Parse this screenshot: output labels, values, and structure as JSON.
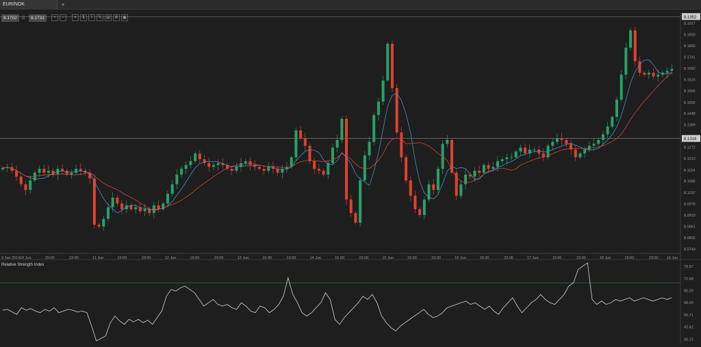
{
  "tab": {
    "title": "EUR/NOK",
    "add": "+"
  },
  "quotes": {
    "bid": "8.1702",
    "sep": "|||",
    "ask": "8.1731"
  },
  "toolbar": {
    "tools": [
      {
        "name": "zoom-in-icon",
        "glyph": "+"
      },
      {
        "name": "zoom-out-icon",
        "glyph": "−"
      },
      {
        "name": "crosshair-icon",
        "glyph": "⌖"
      },
      {
        "name": "candles-icon",
        "glyph": "⫼"
      },
      {
        "name": "indicators-icon",
        "glyph": "⌇"
      },
      {
        "name": "draw-icon",
        "glyph": "✎"
      },
      {
        "name": "template-icon",
        "glyph": "▤"
      },
      {
        "name": "settings-icon",
        "glyph": "⚙"
      },
      {
        "name": "screenshot-icon",
        "glyph": "▣"
      }
    ]
  },
  "rsi": {
    "title": "Relative Strength Index"
  },
  "price_marks": {
    "top": "8.1952",
    "current": "8.1318"
  },
  "colors": {
    "up": "#26a269",
    "down": "#e04030",
    "ma_fast": "#4a90c8",
    "ma_slow": "#d04a3a",
    "rsi_line": "#d8d8d8",
    "rsi_band": "#2e6b3e"
  },
  "chart_data": {
    "type": "candlestick",
    "instrument": "EUR/NOK",
    "price_ticks": [
      "8.1917",
      "8.1859",
      "8.1800",
      "8.1741",
      "8.1682",
      "8.1624",
      "8.1565",
      "8.1506",
      "8.1448",
      "8.1389",
      "8.1272",
      "8.1213",
      "8.1154",
      "8.1096",
      "8.1037",
      "8.0978",
      "8.0919",
      "8.0861",
      "8.0802",
      "8.0743"
    ],
    "ylim": [
      8.072,
      8.196
    ],
    "time_ticks": [
      "9 Jun 2014",
      "10 Jun",
      "15:00",
      "23:00",
      "11 Jun",
      "15:00",
      "23:00",
      "12 Jun",
      "15:00",
      "23:00",
      "13 Jun",
      "15:00",
      "23:00",
      "14 Jun",
      "15:00",
      "23:00",
      "15 Jun",
      "15:00",
      "23:00",
      "16 Jun",
      "15:00",
      "23:00",
      "17 Jun",
      "15:00",
      "23:00",
      "18 Jun",
      "15:00",
      "23:00",
      "19 Jun"
    ],
    "rsi_ticks": [
      "79.87",
      "72.58",
      "65.29",
      "58.00",
      "50.71",
      "43.42",
      "36.13"
    ],
    "rsi_ylim": [
      33,
      84
    ],
    "rsi_levels": [
      70,
      30
    ],
    "close": [
      8.1165,
      8.117,
      8.115,
      8.112,
      8.108,
      8.105,
      8.11,
      8.114,
      8.116,
      8.114,
      8.115,
      8.113,
      8.116,
      8.115,
      8.113,
      8.114,
      8.116,
      8.115,
      8.114,
      8.111,
      8.087,
      8.086,
      8.09,
      8.096,
      8.101,
      8.098,
      8.095,
      8.097,
      8.095,
      8.096,
      8.094,
      8.095,
      8.093,
      8.097,
      8.095,
      8.098,
      8.103,
      8.108,
      8.113,
      8.116,
      8.118,
      8.12,
      8.124,
      8.121,
      8.119,
      8.117,
      8.118,
      8.119,
      8.118,
      8.116,
      8.115,
      8.117,
      8.119,
      8.12,
      8.118,
      8.117,
      8.116,
      8.115,
      8.117,
      8.116,
      8.114,
      8.116,
      8.117,
      8.122,
      8.136,
      8.132,
      8.128,
      8.12,
      8.116,
      8.115,
      8.113,
      8.119,
      8.127,
      8.131,
      8.142,
      8.1,
      8.093,
      8.088,
      8.11,
      8.123,
      8.13,
      8.144,
      8.151,
      8.162,
      8.181,
      8.158,
      8.135,
      8.122,
      8.11,
      8.102,
      8.095,
      8.092,
      8.1,
      8.108,
      8.105,
      8.116,
      8.129,
      8.131,
      8.114,
      8.102,
      8.108,
      8.113,
      8.112,
      8.115,
      8.114,
      8.118,
      8.116,
      8.117,
      8.12,
      8.121,
      8.122,
      8.122,
      8.125,
      8.127,
      8.124,
      8.126,
      8.126,
      8.124,
      8.122,
      8.128,
      8.13,
      8.132,
      8.131,
      8.129,
      8.126,
      8.122,
      8.124,
      8.126,
      8.128,
      8.129,
      8.131,
      8.134,
      8.138,
      8.143,
      8.152,
      8.165,
      8.179,
      8.188,
      8.172,
      8.166,
      8.165,
      8.166,
      8.164,
      8.165,
      8.166,
      8.167,
      8.168
    ],
    "rsi": [
      53.5,
      54.0,
      52.5,
      51.0,
      55.0,
      53.5,
      54.5,
      53.0,
      52.0,
      54.0,
      53.0,
      55.0,
      52.0,
      53.0,
      54.0,
      53.5,
      52.5,
      53.0,
      52.0,
      44.0,
      35.0,
      36.5,
      38.0,
      46.0,
      50.0,
      47.0,
      45.0,
      48.0,
      46.5,
      48.0,
      46.0,
      47.5,
      45.0,
      49.0,
      53.0,
      62.0,
      66.0,
      65.0,
      67.0,
      68.0,
      66.0,
      64.0,
      60.0,
      56.0,
      58.0,
      60.0,
      57.0,
      56.0,
      57.0,
      55.0,
      54.0,
      58.0,
      56.0,
      53.0,
      52.0,
      56.0,
      55.0,
      52.0,
      54.0,
      57.0,
      62.0,
      73.0,
      63.0,
      58.0,
      52.0,
      50.0,
      52.0,
      55.0,
      58.0,
      64.0,
      60.0,
      48.0,
      45.0,
      49.0,
      52.0,
      55.0,
      58.0,
      62.0,
      60.0,
      63.0,
      58.0,
      50.0,
      46.0,
      43.0,
      41.0,
      44.0,
      46.0,
      48.0,
      50.0,
      52.0,
      54.0,
      51.0,
      49.0,
      50.0,
      52.0,
      55.0,
      56.0,
      57.0,
      58.0,
      59.0,
      57.0,
      58.0,
      56.0,
      54.0,
      56.0,
      53.0,
      51.0,
      55.0,
      58.0,
      61.0,
      56.0,
      52.0,
      55.0,
      58.0,
      60.0,
      63.0,
      60.0,
      58.0,
      57.0,
      60.0,
      63.0,
      68.0,
      70.0,
      78.0,
      80.0,
      82.0,
      60.0,
      57.0,
      59.0,
      57.0,
      58.0,
      60.0,
      59.0,
      60.0,
      61.0,
      59.0,
      60.0,
      61.0,
      60.0,
      59.0,
      60.0,
      61.0,
      60.0,
      61.0
    ]
  }
}
